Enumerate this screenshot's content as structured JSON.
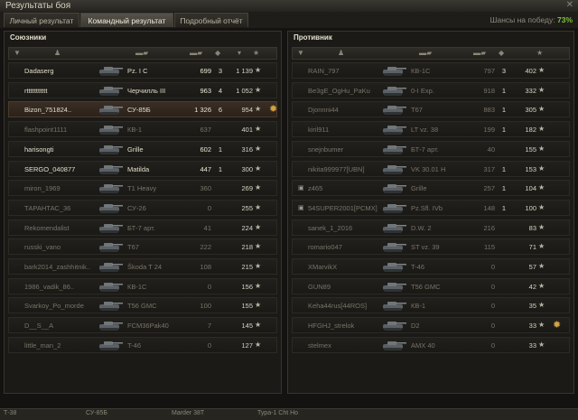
{
  "window": {
    "title": "Результаты боя"
  },
  "tabs": [
    {
      "label": "Личный результат"
    },
    {
      "label": "Командный результат"
    },
    {
      "label": "Подробный отчёт"
    }
  ],
  "win_chance": {
    "label": "Шансы на победу:",
    "value": "73%"
  },
  "allies": {
    "title": "Союзники",
    "rows": [
      {
        "nick": "Dadaserg",
        "tank": "Pz. I C",
        "dmg": "699",
        "frags": "3",
        "xp": "1 139",
        "alive": true
      },
      {
        "nick": "rttttttttttt",
        "tank": "Черчилль III",
        "dmg": "963",
        "frags": "4",
        "xp": "1 052",
        "alive": true
      },
      {
        "nick": "Bizon_751824..",
        "tank": "СУ-85Б",
        "dmg": "1 326",
        "frags": "6",
        "xp": "954",
        "alive": true,
        "self": true,
        "medal": "✹"
      },
      {
        "nick": "flashpoint1111",
        "tank": "КВ-1",
        "dmg": "637",
        "frags": "",
        "xp": "401",
        "alive": false
      },
      {
        "nick": "harisongti",
        "tank": "Grille",
        "dmg": "602",
        "frags": "1",
        "xp": "316",
        "alive": true
      },
      {
        "nick": "SERGO_040877",
        "tank": "Matilda",
        "dmg": "447",
        "frags": "1",
        "xp": "300",
        "alive": true
      },
      {
        "nick": "miron_1969",
        "tank": "T1 Heavy",
        "dmg": "360",
        "frags": "",
        "xp": "269",
        "alive": false
      },
      {
        "nick": "ТАРАНТАС_36",
        "tank": "СУ-26",
        "dmg": "0",
        "frags": "",
        "xp": "255",
        "alive": false
      },
      {
        "nick": "Rekomendalist",
        "tank": "БТ-7 арт.",
        "dmg": "41",
        "frags": "",
        "xp": "224",
        "alive": false
      },
      {
        "nick": "russki_vano",
        "tank": "T67",
        "dmg": "222",
        "frags": "",
        "xp": "218",
        "alive": false
      },
      {
        "nick": "bark2014_zashhitnik..",
        "tank": "Škoda T 24",
        "dmg": "108",
        "frags": "",
        "xp": "215",
        "alive": false
      },
      {
        "nick": "1986_vadik_86..",
        "tank": "КВ-1С",
        "dmg": "0",
        "frags": "",
        "xp": "156",
        "alive": false
      },
      {
        "nick": "Svarkoy_Po_morde",
        "tank": "T56 GMC",
        "dmg": "100",
        "frags": "",
        "xp": "155",
        "alive": false
      },
      {
        "nick": "D__S__A",
        "tank": "FCM36Pak40",
        "dmg": "7",
        "frags": "",
        "xp": "145",
        "alive": false
      },
      {
        "nick": "little_man_2",
        "tank": "T-46",
        "dmg": "0",
        "frags": "",
        "xp": "127",
        "alive": false
      }
    ]
  },
  "enemies": {
    "title": "Противник",
    "rows": [
      {
        "nick": "RAIN_797",
        "tank": "КВ-1С",
        "dmg": "797",
        "frags": "3",
        "xp": "402",
        "alive": false
      },
      {
        "nick": "Be3gE_OgHu_PaKu",
        "tank": "0-I Exp.",
        "dmg": "918",
        "frags": "1",
        "xp": "332",
        "alive": false
      },
      {
        "nick": "Djonnni44",
        "tank": "T67",
        "dmg": "883",
        "frags": "1",
        "xp": "305",
        "alive": false
      },
      {
        "nick": "kiril911",
        "tank": "LT vz. 38",
        "dmg": "199",
        "frags": "1",
        "xp": "182",
        "alive": false
      },
      {
        "nick": "snejnbumer",
        "tank": "БТ-7 арт.",
        "dmg": "40",
        "frags": "",
        "xp": "155",
        "alive": false
      },
      {
        "nick": "nikita999977[UBN]",
        "tank": "VK 30.01 H",
        "dmg": "317",
        "frags": "1",
        "xp": "153",
        "alive": false
      },
      {
        "nick": "z465",
        "tank": "Grille",
        "dmg": "257",
        "frags": "1",
        "xp": "104",
        "alive": false,
        "platoon": "▣"
      },
      {
        "nick": "54SUPER2001[PCMX]",
        "tank": "Pz.Sfl. IVb",
        "dmg": "148",
        "frags": "1",
        "xp": "100",
        "alive": false,
        "platoon": "▣"
      },
      {
        "nick": "sanek_1_2016",
        "tank": "D.W. 2",
        "dmg": "216",
        "frags": "",
        "xp": "83",
        "alive": false
      },
      {
        "nick": "romario047",
        "tank": "ST vz. 39",
        "dmg": "115",
        "frags": "",
        "xp": "71",
        "alive": false
      },
      {
        "nick": "XMarvikX",
        "tank": "T-46",
        "dmg": "0",
        "frags": "",
        "xp": "57",
        "alive": false
      },
      {
        "nick": "GUN89",
        "tank": "T56 GMC",
        "dmg": "0",
        "frags": "",
        "xp": "42",
        "alive": false
      },
      {
        "nick": "Keha44rus[44ROS]",
        "tank": "КВ-1",
        "dmg": "0",
        "frags": "",
        "xp": "35",
        "alive": false
      },
      {
        "nick": "HFGHJ_strelok",
        "tank": "D2",
        "dmg": "0",
        "frags": "",
        "xp": "33",
        "alive": false,
        "medal": "✹"
      },
      {
        "nick": "stelmex",
        "tank": "AMX 40",
        "dmg": "0",
        "frags": "",
        "xp": "33",
        "alive": false
      }
    ]
  },
  "icons": {
    "close": "✕",
    "star": "★",
    "sort": "▾",
    "tank_header": "▬▰",
    "hdr_platoon": "▼",
    "hdr_player": "♟",
    "hdr_frags": "◆"
  },
  "colors": {
    "alive": "#e2ddca",
    "dead": "#787466",
    "win": "#7ec23e",
    "self_row": "#3b2e24"
  },
  "statusbar": [
    "Т-38",
    "СУ-85Б",
    "Marder 38T",
    "Тура-1 Cht Ho"
  ]
}
